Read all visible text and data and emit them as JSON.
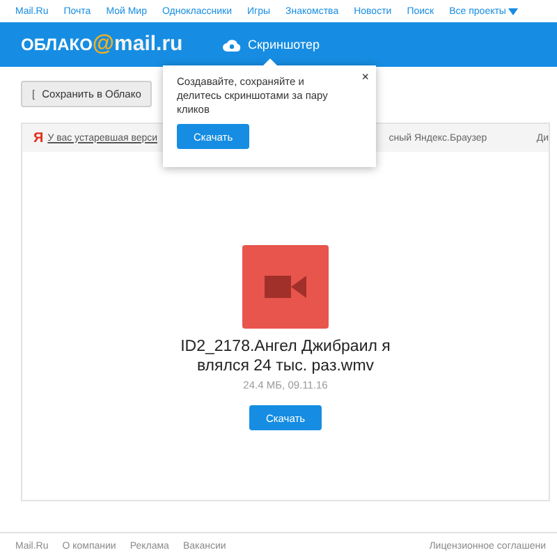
{
  "top_nav": {
    "items": [
      "Mail.Ru",
      "Почта",
      "Мой Мир",
      "Одноклассники",
      "Игры",
      "Знакомства",
      "Новости",
      "Поиск"
    ],
    "all_projects": "Все проекты"
  },
  "header": {
    "logo_left": "ОБЛАКО",
    "logo_at": "@",
    "logo_right": "mail.ru",
    "screenshoter": "Скриншотер"
  },
  "save_button": {
    "icon_text": "[",
    "label": "Сохранить в Облако"
  },
  "popup": {
    "text": "Создавайте, сохраняйте и делитесь скриншотами за пару кликов",
    "button": "Скачать",
    "close": "×"
  },
  "browser_bar": {
    "logo": "Я",
    "left_text": "У вас устаревшая верси",
    "right_text": "сный Яндекс.Браузер",
    "far_right": "Ди"
  },
  "file": {
    "name": "ID2_2178.Ангел Джибраил я влялся 24 тыс. раз.wmv",
    "meta": "24.4 МБ, 09.11.16",
    "button": "Скачать"
  },
  "footer": {
    "left": [
      "Mail.Ru",
      "О компании",
      "Реклама",
      "Вакансии"
    ],
    "right": "Лицензионное соглашени"
  }
}
